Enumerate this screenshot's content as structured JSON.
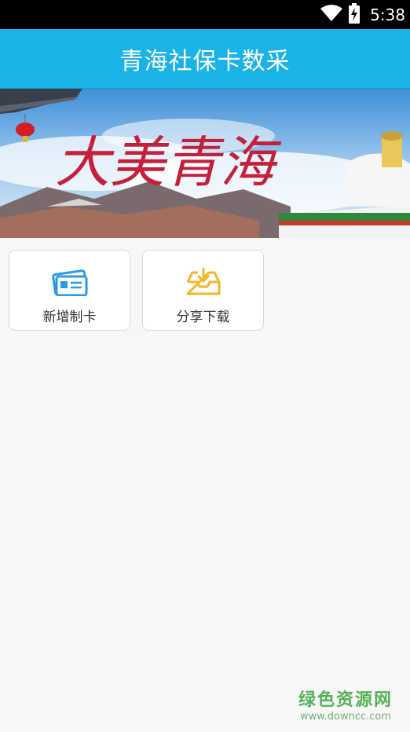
{
  "status_bar": {
    "time": "5:38",
    "icons": [
      "wifi-icon",
      "battery-charging-icon"
    ]
  },
  "app_bar": {
    "title": "青海社保卡数采",
    "color": "#1ab3e6"
  },
  "banner": {
    "calligraphy": "大美青海"
  },
  "actions": [
    {
      "label": "新增制卡",
      "icon": "id-card-icon",
      "color": "#2a9be0"
    },
    {
      "label": "分享下载",
      "icon": "download-tray-icon",
      "color": "#f3b52b"
    }
  ],
  "watermark": {
    "title": "绿色资源网",
    "url": "www.downcc.com"
  }
}
